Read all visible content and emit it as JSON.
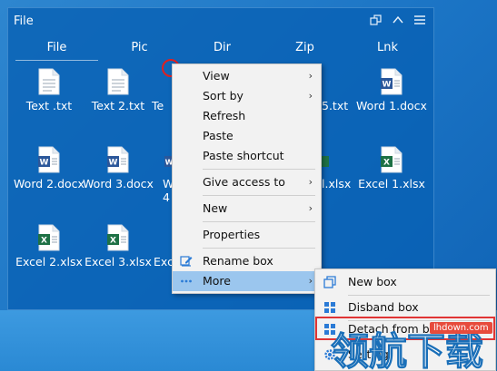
{
  "box": {
    "title": "File",
    "tabs": [
      "File",
      "Pic",
      "Dir",
      "Zip",
      "Lnk"
    ],
    "icons": [
      {
        "label": "Text .txt",
        "type": "txt"
      },
      {
        "label": "Text 2.txt",
        "type": "txt"
      },
      {
        "label": "Te",
        "type": "txt"
      },
      {
        "label": "5.txt",
        "type": "txt"
      },
      {
        "label": "Word 1.docx",
        "type": "docx"
      },
      {
        "label": "Word 2.docx",
        "type": "docx"
      },
      {
        "label": "Word 3.docx",
        "type": "docx"
      },
      {
        "label": "W 4",
        "type": "docx"
      },
      {
        "label": "l.xlsx",
        "type": "xlsx"
      },
      {
        "label": "Excel 1.xlsx",
        "type": "xlsx"
      },
      {
        "label": "Excel 2.xlsx",
        "type": "xlsx"
      },
      {
        "label": "Excel 3.xlsx",
        "type": "xlsx"
      },
      {
        "label": "Exc",
        "type": "xlsx"
      }
    ]
  },
  "context_menu": {
    "items": [
      {
        "label": "View",
        "submenu": true
      },
      {
        "label": "Sort by",
        "submenu": true
      },
      {
        "label": "Refresh"
      },
      {
        "label": "Paste"
      },
      {
        "label": "Paste shortcut"
      },
      {
        "label": "Give access to",
        "submenu": true
      },
      {
        "label": "New",
        "submenu": true
      },
      {
        "label": "Properties"
      },
      {
        "label": "Rename box"
      },
      {
        "label": "More",
        "submenu": true
      }
    ]
  },
  "more_submenu": {
    "items": [
      {
        "label": "New box"
      },
      {
        "label": "Disband box"
      },
      {
        "label": "Detach from boxes"
      },
      {
        "label": "Setting"
      }
    ]
  },
  "watermark": {
    "text": "领航下载",
    "url": "lhdown.com"
  },
  "colors": {
    "box_bg": "#0860b4",
    "menu_bg": "#f2f2f2",
    "menu_hover": "#9bc6ee",
    "highlight": "#e03535",
    "excel_green": "#1e7145",
    "word_blue": "#2b579a"
  }
}
